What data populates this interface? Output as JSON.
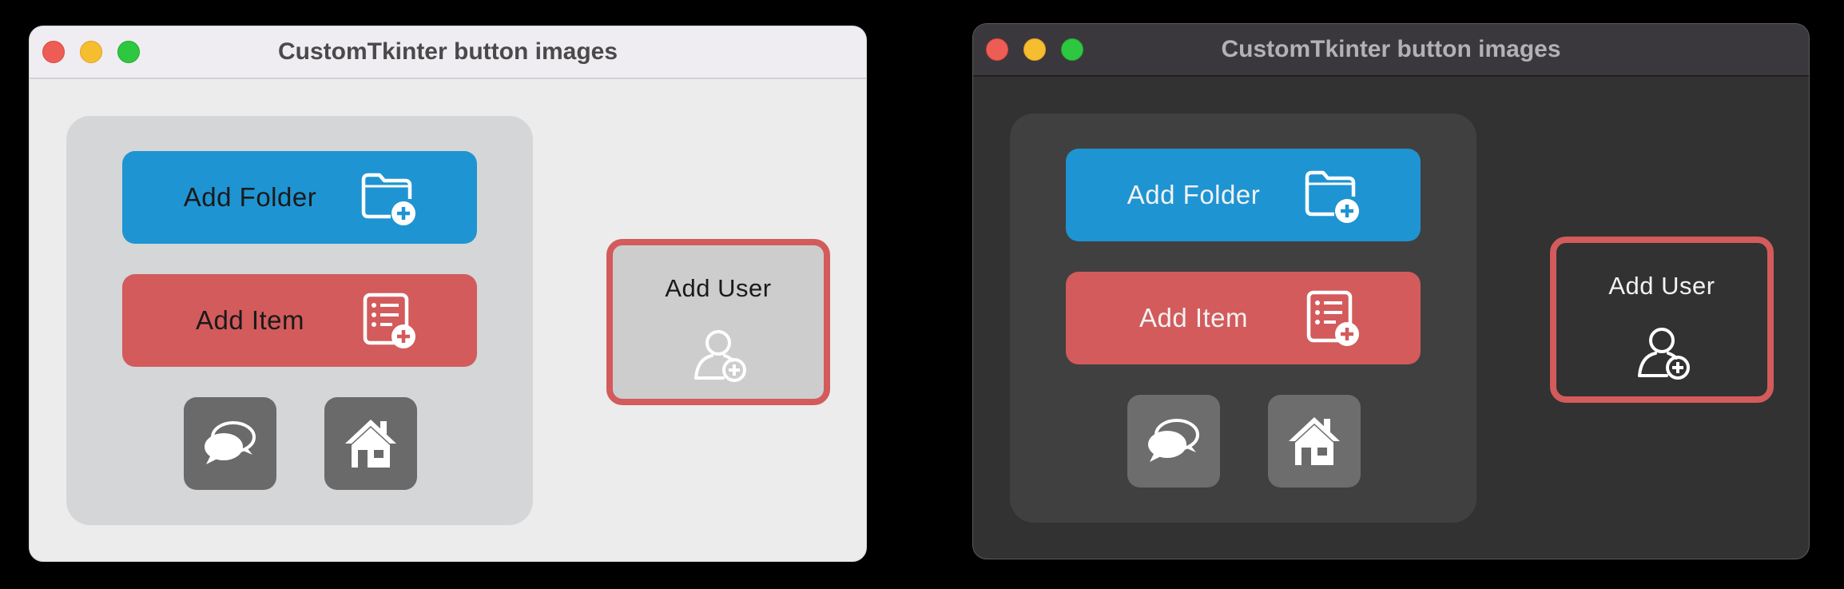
{
  "windows": [
    {
      "theme": "light",
      "title": "CustomTkinter button images",
      "buttons": {
        "add_folder": {
          "label": "Add Folder",
          "icon": "folder-plus-icon",
          "color": "#1f94d2"
        },
        "add_item": {
          "label": "Add Item",
          "icon": "list-plus-icon",
          "color": "#d35b5c"
        },
        "chat": {
          "icon": "chat-bubbles-icon"
        },
        "home": {
          "icon": "home-icon"
        },
        "add_user": {
          "label": "Add User",
          "icon": "user-plus-icon",
          "border_color": "#d35b5c"
        }
      }
    },
    {
      "theme": "dark",
      "title": "CustomTkinter button images",
      "buttons": {
        "add_folder": {
          "label": "Add Folder",
          "icon": "folder-plus-icon",
          "color": "#1f94d2"
        },
        "add_item": {
          "label": "Add Item",
          "icon": "list-plus-icon",
          "color": "#d35b5c"
        },
        "chat": {
          "icon": "chat-bubbles-icon"
        },
        "home": {
          "icon": "home-icon"
        },
        "add_user": {
          "label": "Add User",
          "icon": "user-plus-icon",
          "border_color": "#d35b5c"
        }
      }
    }
  ]
}
